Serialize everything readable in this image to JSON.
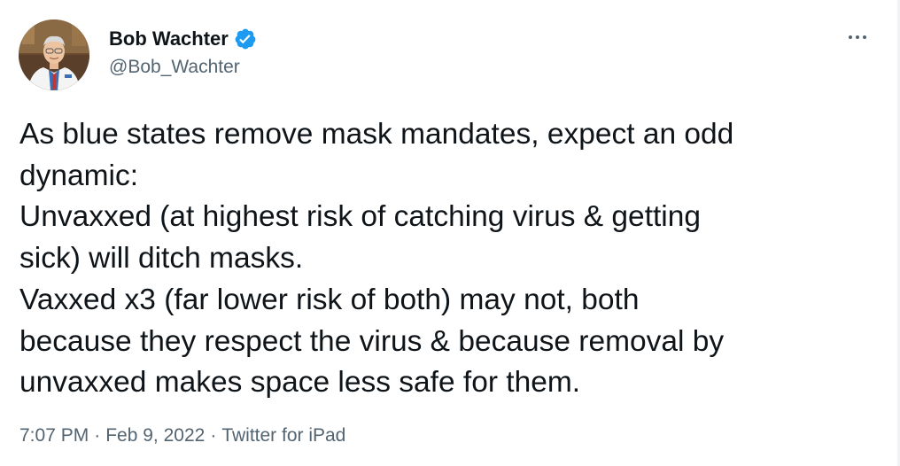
{
  "author": {
    "display_name": "Bob Wachter",
    "handle": "@Bob_Wachter",
    "verified": true,
    "avatar_icon": "profile-photo-doctor-white-coat"
  },
  "more_icon": "more-horizontal-icon",
  "tweet": {
    "lines": [
      "As blue states remove mask mandates, expect an odd",
      "dynamic:",
      "Unvaxxed (at highest risk of catching virus & getting",
      "sick) will ditch masks.",
      "Vaxxed x3 (far lower risk of both) may not, both",
      "because they respect the virus & because removal by",
      "unvaxxed makes space less safe for them."
    ]
  },
  "meta": {
    "time": "7:07 PM",
    "separator": "·",
    "date": "Feb 9, 2022",
    "source": "Twitter for iPad"
  },
  "colors": {
    "text_primary": "#0f1419",
    "text_secondary": "#536471",
    "verified_blue": "#1d9bf0",
    "background": "#ffffff"
  }
}
